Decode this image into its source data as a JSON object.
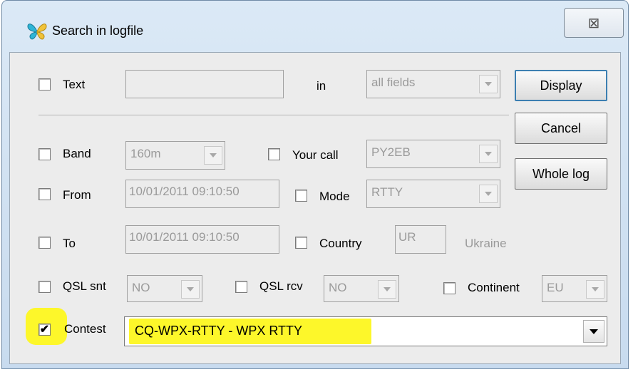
{
  "window": {
    "title": "Search in logfile",
    "close_symbol": "⊠",
    "icon": "butterfly-icon"
  },
  "filters": {
    "text": {
      "label": "Text",
      "value": "",
      "in_label": "in",
      "fields_select": "all fields",
      "checked": false
    },
    "band": {
      "label": "Band",
      "value": "160m",
      "checked": false
    },
    "your_call": {
      "label": "Your call",
      "value": "PY2EB",
      "checked": false
    },
    "from": {
      "label": "From",
      "value": "10/01/2011 09:10:50",
      "checked": false
    },
    "mode": {
      "label": "Mode",
      "value": "RTTY",
      "checked": false
    },
    "to": {
      "label": "To",
      "value": "10/01/2011 09:10:50",
      "checked": false
    },
    "country": {
      "label": "Country",
      "value": "UR",
      "name": "Ukraine",
      "checked": false
    },
    "qsl_snt": {
      "label": "QSL snt",
      "value": "NO",
      "checked": false
    },
    "qsl_rcv": {
      "label": "QSL rcv",
      "value": "NO",
      "checked": false
    },
    "continent": {
      "label": "Continent",
      "value": "EU",
      "checked": false
    },
    "contest": {
      "label": "Contest",
      "value": "CQ-WPX-RTTY - WPX RTTY",
      "checked": true,
      "check_mark": "✔"
    }
  },
  "buttons": {
    "display": "Display",
    "cancel": "Cancel",
    "whole_log": "Whole log"
  },
  "colors": {
    "highlight": "#fdf72a",
    "default_button_border": "#3c7fb1"
  }
}
